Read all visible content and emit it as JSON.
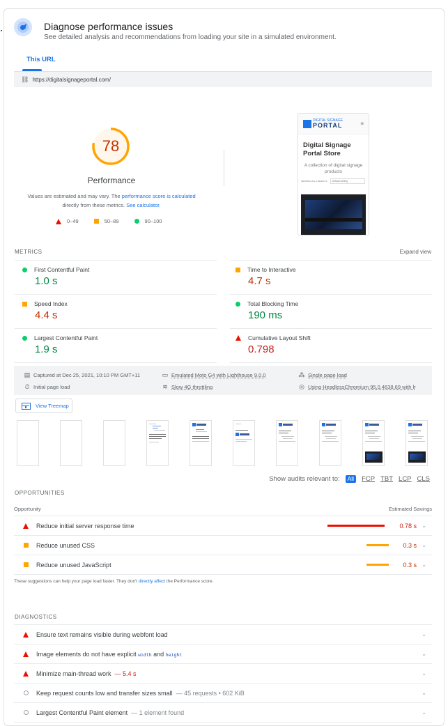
{
  "header": {
    "title": "Diagnose performance issues",
    "subtitle": "See detailed analysis and recommendations from loading your site in a simulated environment.",
    "icon": "lighthouse-gauge-icon"
  },
  "tabs": [
    {
      "label": "This URL",
      "active": true
    }
  ],
  "url": {
    "icon": "link-icon",
    "value": "https://digitalsignageportal.com/"
  },
  "score": {
    "value": 78,
    "fraction": 0.78,
    "label": "Performance",
    "desc_prefix": "Values are estimated and may vary. The ",
    "desc_link1": "performance score is calculated",
    "desc_mid": " directly from these metrics. ",
    "desc_link2": "See calculator.",
    "color": "#ffa400",
    "legend": [
      {
        "shape": "triangle",
        "label": "0–49",
        "color": "#eb0f00"
      },
      {
        "shape": "square",
        "label": "50–89",
        "color": "#ffa400"
      },
      {
        "shape": "circle",
        "label": "90–100",
        "color": "#0cce6b"
      }
    ]
  },
  "screenshot": {
    "logo_small": "DIGITAL SIGNAGE",
    "logo_big": "PORTAL",
    "menu_icon": "≡",
    "title": "Digital Signage Portal Store",
    "subtitle": "A collection of digital signage products",
    "sort_label": "SHOWING ALL 4 RESULTS",
    "sort_value": "Default sorting"
  },
  "metrics": {
    "label": "METRICS",
    "expand": "Expand view",
    "items": [
      {
        "name": "First Contentful Paint",
        "value": "1.0 s",
        "status": "good"
      },
      {
        "name": "Time to Interactive",
        "value": "4.7 s",
        "status": "average"
      },
      {
        "name": "Speed Index",
        "value": "4.4 s",
        "status": "average"
      },
      {
        "name": "Total Blocking Time",
        "value": "190 ms",
        "status": "good"
      },
      {
        "name": "Largest Contentful Paint",
        "value": "1.9 s",
        "status": "good"
      },
      {
        "name": "Cumulative Layout Shift",
        "value": "0.798",
        "status": "fail"
      }
    ]
  },
  "meta": {
    "captured": "Captured at Dec 25, 2021, 10:10 PM GMT+11",
    "initial": "Initial page load",
    "emulated": "Emulated Moto G4 with Lighthouse 9.0.0",
    "throttling": "Slow 4G throttling",
    "single": "Single page load",
    "browser": "Using HeadlessChromium 95.0.4638.69 with lr"
  },
  "treemap": {
    "label": "View Treemap"
  },
  "filmstrip": {
    "frames": [
      "blank",
      "blank",
      "blank",
      "text",
      "logo-text",
      "text-logo",
      "page",
      "page",
      "page-image",
      "page-image"
    ]
  },
  "audit_filter": {
    "label": "Show audits relevant to:",
    "options": [
      "All",
      "FCP",
      "TBT",
      "LCP",
      "CLS"
    ],
    "active": "All"
  },
  "opportunities": {
    "label": "OPPORTUNITIES",
    "col_left": "Opportunity",
    "col_right": "Estimated Savings",
    "items": [
      {
        "title": "Reduce initial server response time",
        "savings": "0.78 s",
        "savings_s": 0.78,
        "status": "fail"
      },
      {
        "title": "Reduce unused CSS",
        "savings": "0.3 s",
        "savings_s": 0.3,
        "status": "average"
      },
      {
        "title": "Reduce unused JavaScript",
        "savings": "0.3 s",
        "savings_s": 0.3,
        "status": "average"
      }
    ],
    "note_prefix": "These suggestions can help your page load faster. They don't ",
    "note_link": "directly affect",
    "note_suffix": " the Performance score."
  },
  "diagnostics": {
    "label": "DIAGNOSTICS",
    "items": [
      {
        "title": "Ensure text remains visible during webfont load",
        "status": "fail"
      },
      {
        "title_a": "Image elements do not have explicit ",
        "code1": "width",
        "title_b": " and ",
        "code2": "height",
        "status": "fail"
      },
      {
        "title": "Minimize main-thread work",
        "extra": "— 5.4 s",
        "status": "fail"
      },
      {
        "title": "Keep request counts low and transfer sizes small",
        "extra": "— 45 requests • 602 KiB",
        "status": "info"
      },
      {
        "title": "Largest Contentful Paint element",
        "extra": "— 1 element found",
        "status": "info"
      }
    ]
  }
}
